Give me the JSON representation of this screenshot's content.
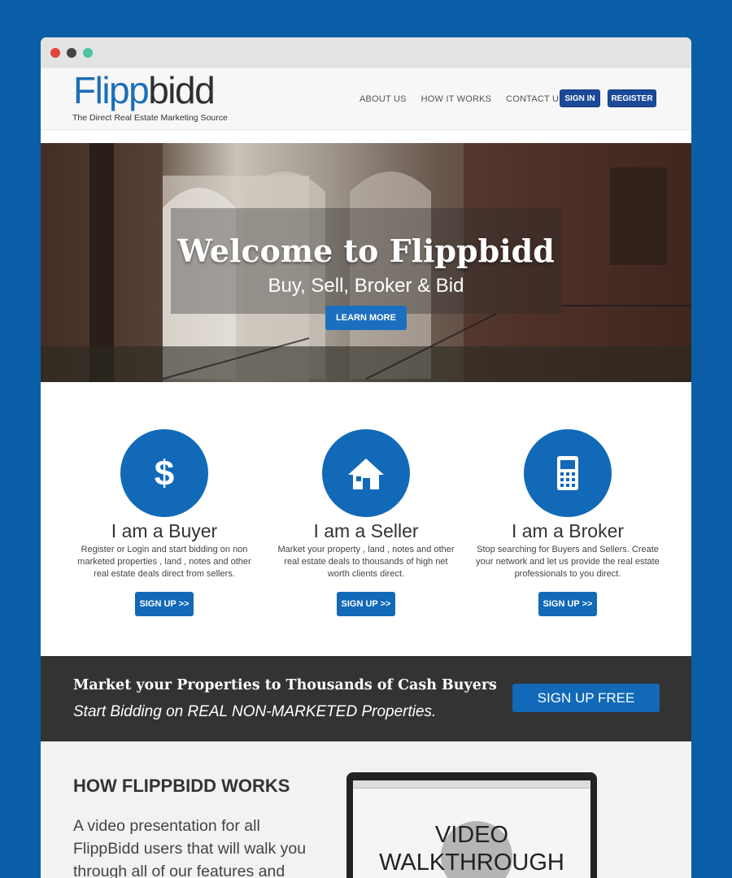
{
  "colors": {
    "background": "#0a5ea8",
    "primary": "#1169b8",
    "dark_button": "#1b4a99",
    "dark_band": "#333333"
  },
  "brand": {
    "logo_part1": "Flipp",
    "logo_part2": "bidd",
    "tagline": "The Direct Real Estate Marketing Source"
  },
  "nav": {
    "items": [
      "ABOUT US",
      "HOW IT WORKS",
      "CONTACT US"
    ],
    "sign_in": "SIGN IN",
    "register": "REGISTER"
  },
  "hero": {
    "title": "Welcome to Flippbidd",
    "subtitle": "Buy, Sell, Broker & Bid",
    "button": "LEARN MORE"
  },
  "features": [
    {
      "icon": "dollar-icon",
      "title": "I am a Buyer",
      "text": "Register or Login and start bidding on non marketed properties , land , notes and other real estate deals direct from sellers.",
      "button": "SIGN UP >>"
    },
    {
      "icon": "house-icon",
      "title": "I am a Seller",
      "text": "Market your property , land , notes and other real estate deals to thousands of high net worth clients direct.",
      "button": "SIGN UP >>"
    },
    {
      "icon": "phone-icon",
      "title": "I am a Broker",
      "text": "Stop searching for Buyers and Sellers. Create your network and let us provide the real estate professionals to you direct.",
      "button": "SIGN UP >>"
    }
  ],
  "cta": {
    "title": "Market your Properties to Thousands of Cash Buyers",
    "subtitle": "Start Bidding on REAL NON-MARKETED Properties.",
    "button": "SIGN UP FREE"
  },
  "how": {
    "heading": "HOW FLIPPBIDD WORKS",
    "text": "A video presentation for all FlippBidd users that will walk you through all of our features and",
    "video_line1": "VIDEO",
    "video_line2": "WALKTHROUGH"
  }
}
